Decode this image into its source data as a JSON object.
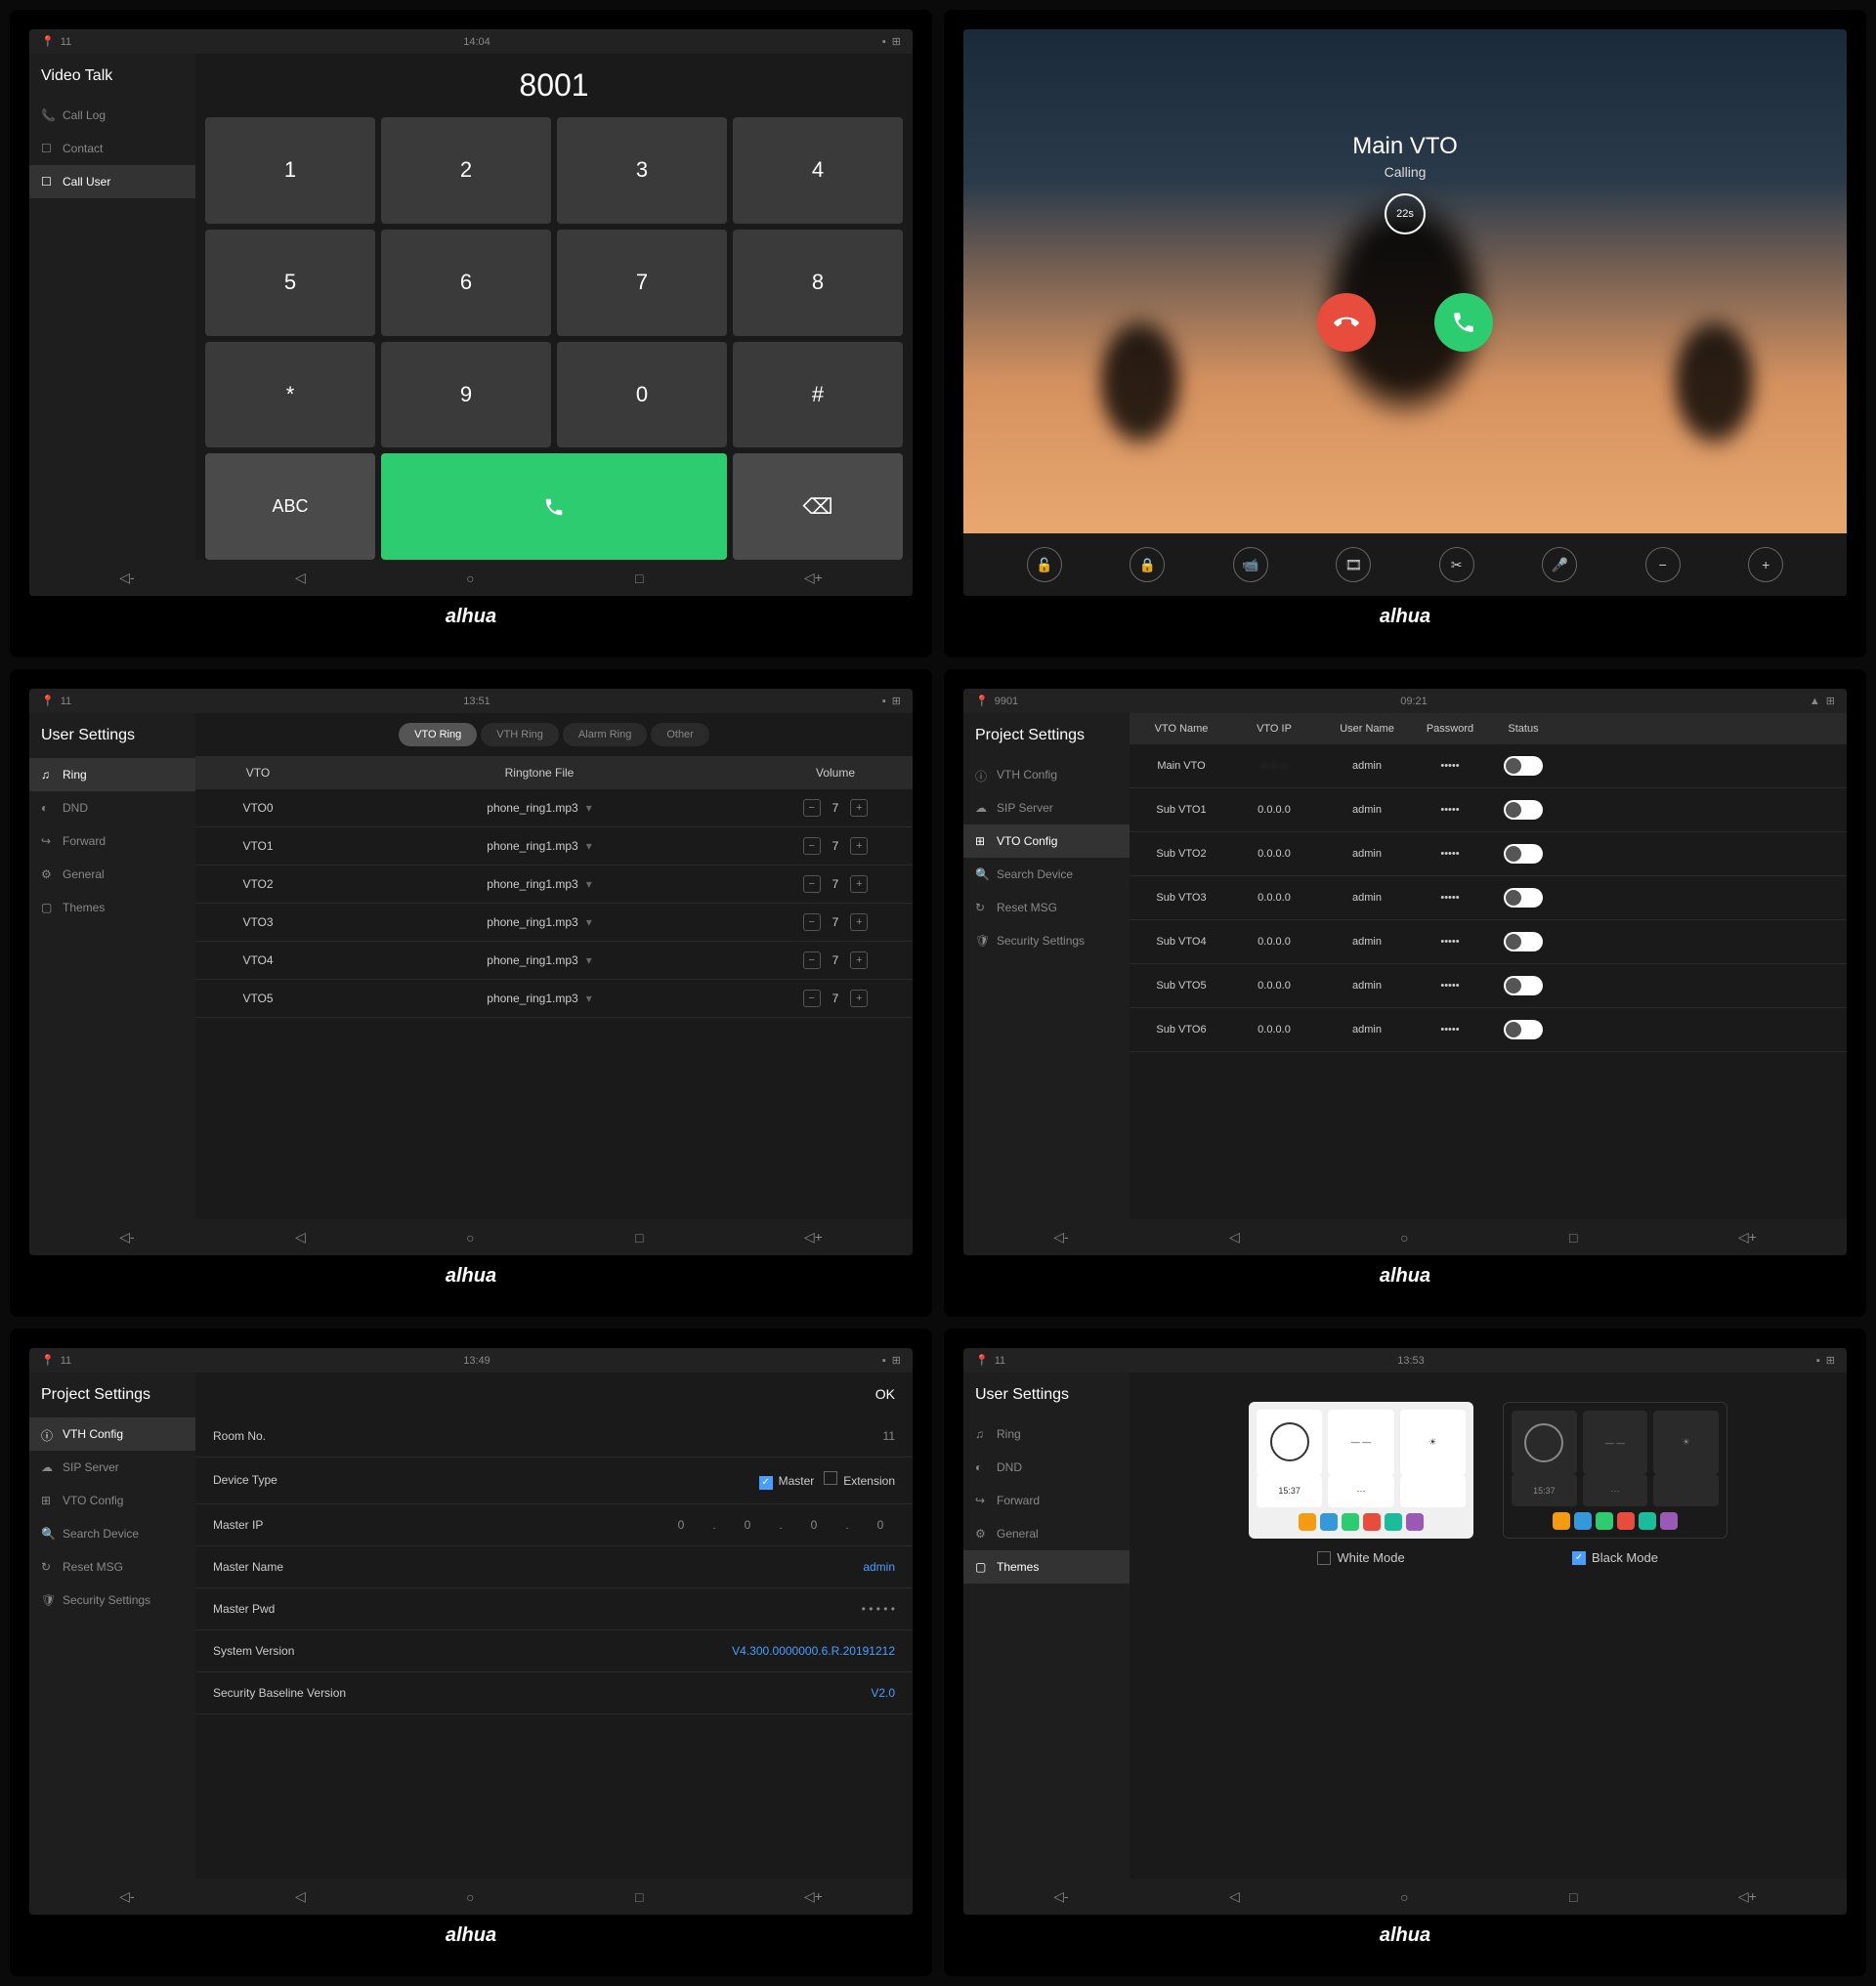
{
  "logo": "alhua",
  "nav": {
    "vol_down": "◁-",
    "back": "◁",
    "home": "○",
    "recent": "□",
    "vol_up": "◁+"
  },
  "s1": {
    "status": {
      "loc": "11",
      "time": "14:04"
    },
    "title": "Video Talk",
    "menu": [
      {
        "icon": "📞",
        "label": "Call Log"
      },
      {
        "icon": "☐",
        "label": "Contact"
      },
      {
        "icon": "☐",
        "label": "Call User",
        "active": true
      }
    ],
    "display": "8001",
    "keys": [
      "1",
      "2",
      "3",
      "4",
      "5",
      "6",
      "7",
      "8",
      "*",
      "9",
      "0",
      "#"
    ],
    "abc": "ABC",
    "del": "⌫"
  },
  "s2": {
    "title": "Main VTO",
    "sub": "Calling",
    "timer": "22s",
    "tools": [
      "🔓",
      "🔒",
      "📹",
      "🎞",
      "✂",
      "🎤",
      "−",
      "+"
    ]
  },
  "s3": {
    "status": {
      "loc": "11",
      "time": "13:51"
    },
    "title": "User Settings",
    "menu": [
      {
        "icon": "♫",
        "label": "Ring",
        "active": true
      },
      {
        "icon": "◐",
        "label": "DND"
      },
      {
        "icon": "↪",
        "label": "Forward"
      },
      {
        "icon": "⚙",
        "label": "General"
      },
      {
        "icon": "▢",
        "label": "Themes"
      }
    ],
    "tabs": [
      "VTO Ring",
      "VTH Ring",
      "Alarm Ring",
      "Other"
    ],
    "headers": [
      "VTO",
      "Ringtone File",
      "Volume"
    ],
    "rows": [
      {
        "vto": "VTO0",
        "file": "phone_ring1.mp3",
        "vol": "7"
      },
      {
        "vto": "VTO1",
        "file": "phone_ring1.mp3",
        "vol": "7"
      },
      {
        "vto": "VTO2",
        "file": "phone_ring1.mp3",
        "vol": "7"
      },
      {
        "vto": "VTO3",
        "file": "phone_ring1.mp3",
        "vol": "7"
      },
      {
        "vto": "VTO4",
        "file": "phone_ring1.mp3",
        "vol": "7"
      },
      {
        "vto": "VTO5",
        "file": "phone_ring1.mp3",
        "vol": "7"
      }
    ]
  },
  "s4": {
    "status": {
      "loc": "9901",
      "time": "09:21"
    },
    "title": "Project Settings",
    "menu": [
      {
        "icon": "ⓘ",
        "label": "VTH Config"
      },
      {
        "icon": "☁",
        "label": "SIP Server"
      },
      {
        "icon": "⊞",
        "label": "VTO Config",
        "active": true
      },
      {
        "icon": "🔍",
        "label": "Search Device"
      },
      {
        "icon": "↻",
        "label": "Reset MSG"
      },
      {
        "icon": "🛡",
        "label": "Security Settings"
      }
    ],
    "headers": [
      "VTO Name",
      "VTO IP",
      "User Name",
      "Password",
      "Status"
    ],
    "rows": [
      {
        "name": "Main VTO",
        "ip": "-- -- --",
        "user": "admin",
        "pwd": "•••••",
        "blur": true
      },
      {
        "name": "Sub VTO1",
        "ip": "0.0.0.0",
        "user": "admin",
        "pwd": "•••••"
      },
      {
        "name": "Sub VTO2",
        "ip": "0.0.0.0",
        "user": "admin",
        "pwd": "•••••"
      },
      {
        "name": "Sub VTO3",
        "ip": "0.0.0.0",
        "user": "admin",
        "pwd": "•••••"
      },
      {
        "name": "Sub VTO4",
        "ip": "0.0.0.0",
        "user": "admin",
        "pwd": "•••••"
      },
      {
        "name": "Sub VTO5",
        "ip": "0.0.0.0",
        "user": "admin",
        "pwd": "•••••"
      },
      {
        "name": "Sub VTO6",
        "ip": "0.0.0.0",
        "user": "admin",
        "pwd": "•••••"
      }
    ]
  },
  "s5": {
    "status": {
      "loc": "11",
      "time": "13:49"
    },
    "title": "Project Settings",
    "ok": "OK",
    "menu": [
      {
        "icon": "ⓘ",
        "label": "VTH Config",
        "active": true
      },
      {
        "icon": "☁",
        "label": "SIP Server"
      },
      {
        "icon": "⊞",
        "label": "VTO Config"
      },
      {
        "icon": "🔍",
        "label": "Search Device"
      },
      {
        "icon": "↻",
        "label": "Reset MSG"
      },
      {
        "icon": "🛡",
        "label": "Security Settings"
      }
    ],
    "rows": [
      {
        "label": "Room No.",
        "val": "11"
      },
      {
        "label": "Device Type",
        "master": "Master",
        "ext": "Extension"
      },
      {
        "label": "Master IP",
        "ip": [
          "0",
          "0",
          "0",
          "0"
        ]
      },
      {
        "label": "Master Name",
        "val": "admin",
        "link": true
      },
      {
        "label": "Master Pwd",
        "val": "• • • • •"
      },
      {
        "label": "System Version",
        "val": "V4.300.0000000.6.R.20191212",
        "link": true
      },
      {
        "label": "Security Baseline Version",
        "val": "V2.0",
        "link": true
      }
    ]
  },
  "s6": {
    "status": {
      "loc": "11",
      "time": "13:53"
    },
    "title": "User Settings",
    "menu": [
      {
        "icon": "♫",
        "label": "Ring"
      },
      {
        "icon": "◐",
        "label": "DND"
      },
      {
        "icon": "↪",
        "label": "Forward"
      },
      {
        "icon": "⚙",
        "label": "General"
      },
      {
        "icon": "▢",
        "label": "Themes",
        "active": true
      }
    ],
    "white": "White Mode",
    "black": "Black Mode",
    "time": "15:37"
  }
}
